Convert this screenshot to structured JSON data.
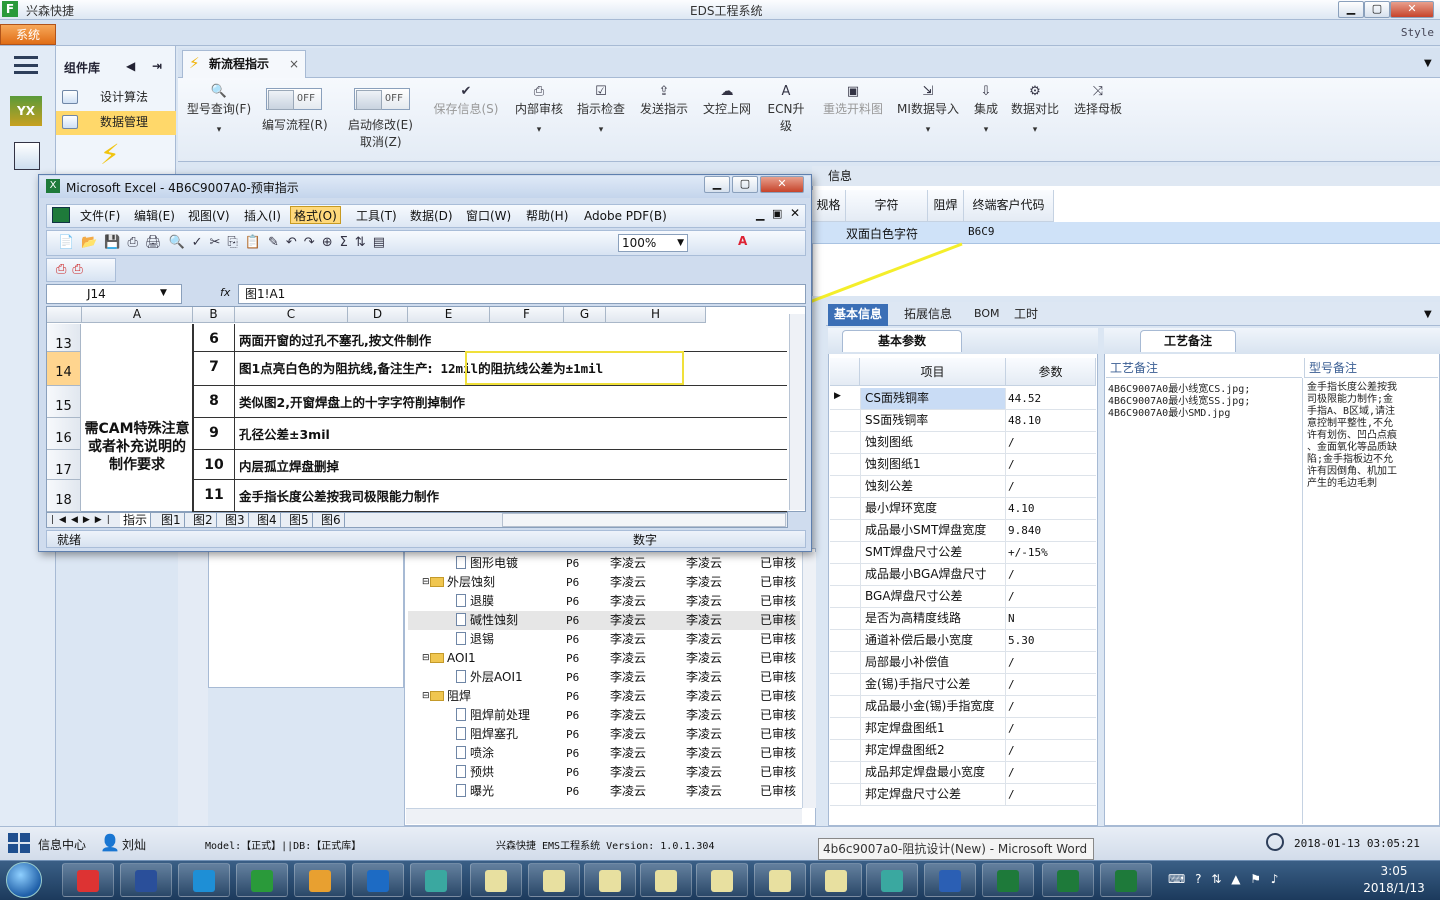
{
  "titlebar": {
    "app_name": "兴森快捷",
    "window_title": "EDS工程系统"
  },
  "menu": {
    "system_label": "系统",
    "style_label": "Style"
  },
  "component_lib": {
    "title": "组件库",
    "items": [
      {
        "label": "设计算法"
      },
      {
        "label": "数据管理"
      }
    ]
  },
  "tab": {
    "label": "新流程指示",
    "close": "×"
  },
  "ribbon": {
    "model_query": "型号查询(F)",
    "edit_flow": "编写流程(R)",
    "enable_edit": "启动修改(E)",
    "cancel": "取消(Z)",
    "off1": "OFF",
    "off2": "OFF",
    "buttons": [
      {
        "label": "保存信息(S)",
        "icon": "check-icon",
        "enabled": false
      },
      {
        "label": "内部审核",
        "icon": "printer-icon",
        "enabled": true
      },
      {
        "label": "指示检查",
        "icon": "checkbox-icon",
        "enabled": true
      },
      {
        "label": "发送指示",
        "icon": "upload-icon",
        "enabled": true
      },
      {
        "label": "文控上网",
        "icon": "cloud-upload-icon",
        "enabled": true
      },
      {
        "label": "ECN升级",
        "icon": "ecn-icon",
        "enabled": true
      },
      {
        "label": "重选开料图",
        "icon": "image-icon",
        "enabled": false
      },
      {
        "label": "MI数据导入",
        "icon": "import-icon",
        "enabled": true
      },
      {
        "label": "集成",
        "icon": "download-icon",
        "enabled": true
      },
      {
        "label": "数据对比",
        "icon": "compare-icon",
        "enabled": true
      },
      {
        "label": "选择母板",
        "icon": "shuffle-icon",
        "enabled": true
      }
    ]
  },
  "top_grid": {
    "partial_title": "信息",
    "headers": [
      "规格",
      "字符",
      "阻焊",
      "终端客户代码"
    ],
    "row": {
      "char": "双面白色字符",
      "code": "B6C9"
    }
  },
  "info_tabs": [
    "基本信息",
    "拓展信息",
    "BOM",
    "工时"
  ],
  "basic_params": {
    "title": "基本参数",
    "col_item": "项目",
    "col_value": "参数",
    "rows": [
      {
        "k": "CS面残铜率",
        "v": "44.52"
      },
      {
        "k": "SS面残铜率",
        "v": "48.10"
      },
      {
        "k": "蚀刻图纸",
        "v": "/"
      },
      {
        "k": "蚀刻图纸1",
        "v": "/"
      },
      {
        "k": "蚀刻公差",
        "v": "/"
      },
      {
        "k": "最小焊环宽度",
        "v": "4.10"
      },
      {
        "k": "成品最小SMT焊盘宽度",
        "v": "9.840"
      },
      {
        "k": "SMT焊盘尺寸公差",
        "v": "+/-15%"
      },
      {
        "k": "成品最小BGA焊盘尺寸",
        "v": "/"
      },
      {
        "k": "BGA焊盘尺寸公差",
        "v": "/"
      },
      {
        "k": "是否为高精度线路",
        "v": "N"
      },
      {
        "k": "通道补偿后最小宽度",
        "v": "5.30"
      },
      {
        "k": "局部最小补偿值",
        "v": "/"
      },
      {
        "k": "金(锡)手指尺寸公差",
        "v": "/"
      },
      {
        "k": "成品最小金(锡)手指宽度",
        "v": "/"
      },
      {
        "k": "邦定焊盘图纸1",
        "v": "/"
      },
      {
        "k": "邦定焊盘图纸2",
        "v": "/"
      },
      {
        "k": "成品邦定焊盘最小宽度",
        "v": "/"
      },
      {
        "k": "邦定焊盘尺寸公差",
        "v": "/"
      }
    ]
  },
  "notes": {
    "title": "工艺备注",
    "col1": "工艺备注",
    "col2": "型号备注",
    "text1": "4B6C9007A0最小线宽CS.jpg;\n4B6C9007A0最小线宽SS.jpg;\n4B6C9007A0最小SMD.jpg",
    "text2": "金手指长度公差按我\n司极限能力制作;金\n手指A、B区域,请注\n意控制平整性,不允\n许有划伤、凹凸点痕\n、金面氧化等品质缺\n陷;金手指板边不允\n许有因倒角、机加工\n产生的毛边毛刺"
  },
  "tree": {
    "rows": [
      {
        "indent": 1,
        "type": "doc",
        "name": "图形电镀",
        "code": "P6",
        "p1": "李凌云",
        "p2": "李凌云",
        "status": "已审核"
      },
      {
        "indent": 0,
        "type": "folder",
        "name": "外层蚀刻",
        "code": "P6",
        "p1": "李凌云",
        "p2": "李凌云",
        "status": "已审核"
      },
      {
        "indent": 1,
        "type": "doc",
        "name": "退膜",
        "code": "P6",
        "p1": "李凌云",
        "p2": "李凌云",
        "status": "已审核"
      },
      {
        "indent": 1,
        "type": "doc",
        "name": "碱性蚀刻",
        "code": "P6",
        "p1": "李凌云",
        "p2": "李凌云",
        "status": "已审核"
      },
      {
        "indent": 1,
        "type": "doc",
        "name": "退锡",
        "code": "P6",
        "p1": "李凌云",
        "p2": "李凌云",
        "status": "已审核"
      },
      {
        "indent": 0,
        "type": "folder",
        "name": "AOI1",
        "code": "P6",
        "p1": "李凌云",
        "p2": "李凌云",
        "status": "已审核"
      },
      {
        "indent": 1,
        "type": "doc",
        "name": "外层AOI1",
        "code": "P6",
        "p1": "李凌云",
        "p2": "李凌云",
        "status": "已审核"
      },
      {
        "indent": 0,
        "type": "folder",
        "name": "阻焊",
        "code": "P6",
        "p1": "李凌云",
        "p2": "李凌云",
        "status": "已审核"
      },
      {
        "indent": 1,
        "type": "doc",
        "name": "阻焊前处理",
        "code": "P6",
        "p1": "李凌云",
        "p2": "李凌云",
        "status": "已审核"
      },
      {
        "indent": 1,
        "type": "doc",
        "name": "阻焊塞孔",
        "code": "P6",
        "p1": "李凌云",
        "p2": "李凌云",
        "status": "已审核"
      },
      {
        "indent": 1,
        "type": "doc",
        "name": "喷涂",
        "code": "P6",
        "p1": "李凌云",
        "p2": "李凌云",
        "status": "已审核"
      },
      {
        "indent": 1,
        "type": "doc",
        "name": "预烘",
        "code": "P6",
        "p1": "李凌云",
        "p2": "李凌云",
        "status": "已审核"
      },
      {
        "indent": 1,
        "type": "doc",
        "name": "曝光",
        "code": "P6",
        "p1": "李凌云",
        "p2": "李凌云",
        "status": "已审核"
      }
    ]
  },
  "excel": {
    "title": "Microsoft Excel - 4B6C9007A0-预审指示",
    "menus": [
      "文件(F)",
      "编辑(E)",
      "视图(V)",
      "插入(I)",
      "格式(O)",
      "工具(T)",
      "数据(D)",
      "窗口(W)",
      "帮助(H)",
      "Adobe PDF(B)"
    ],
    "zoom": "100%",
    "name_box": "J14",
    "fx": "fx",
    "formula": "图1!A1",
    "columns": [
      "A",
      "B",
      "C",
      "D",
      "E",
      "F",
      "G",
      "H"
    ],
    "merged_a": "需CAM特殊注意或者补充说明的制作要求",
    "rows": [
      {
        "num": "13",
        "b": "6",
        "c": "两面开窗的过孔不塞孔,按文件制作"
      },
      {
        "num": "14",
        "b": "7",
        "c": "图1点亮白色的为阻抗线,备注生产:",
        "c2": "12mil的阻抗线公差为±1mil"
      },
      {
        "num": "15",
        "b": "8",
        "c": "类似图2,开窗焊盘上的十字字符削掉制作"
      },
      {
        "num": "16",
        "b": "9",
        "c": "孔径公差±3mil"
      },
      {
        "num": "17",
        "b": "10",
        "c": "内层孤立焊盘删掉"
      },
      {
        "num": "18",
        "b": "11",
        "c": "金手指长度公差按我司极限能力制作"
      }
    ],
    "sheet_tabs": [
      "指示",
      "图1",
      "图2",
      "图3",
      "图4",
      "图5",
      "图6"
    ],
    "status_left": "就绪",
    "status_num": "数字"
  },
  "statusbar": {
    "info_center": "信息中心",
    "user": "刘灿",
    "model_db": "Model:【正式】||DB:【正式库】",
    "system_version": "兴森快捷 EMS工程系统 Version: 1.0.1.304",
    "datetime": "2018-01-13 03:05:21"
  },
  "tooltip": "4b6c9007a0-阻抗设计(New) - Microsoft Word",
  "taskbar": {
    "time": "3:05",
    "date": "2018/1/13"
  },
  "colors": {
    "accent": "#3b6fb6",
    "system_orange": "#e06d16",
    "arrow_yellow": "#f4ee2a"
  }
}
